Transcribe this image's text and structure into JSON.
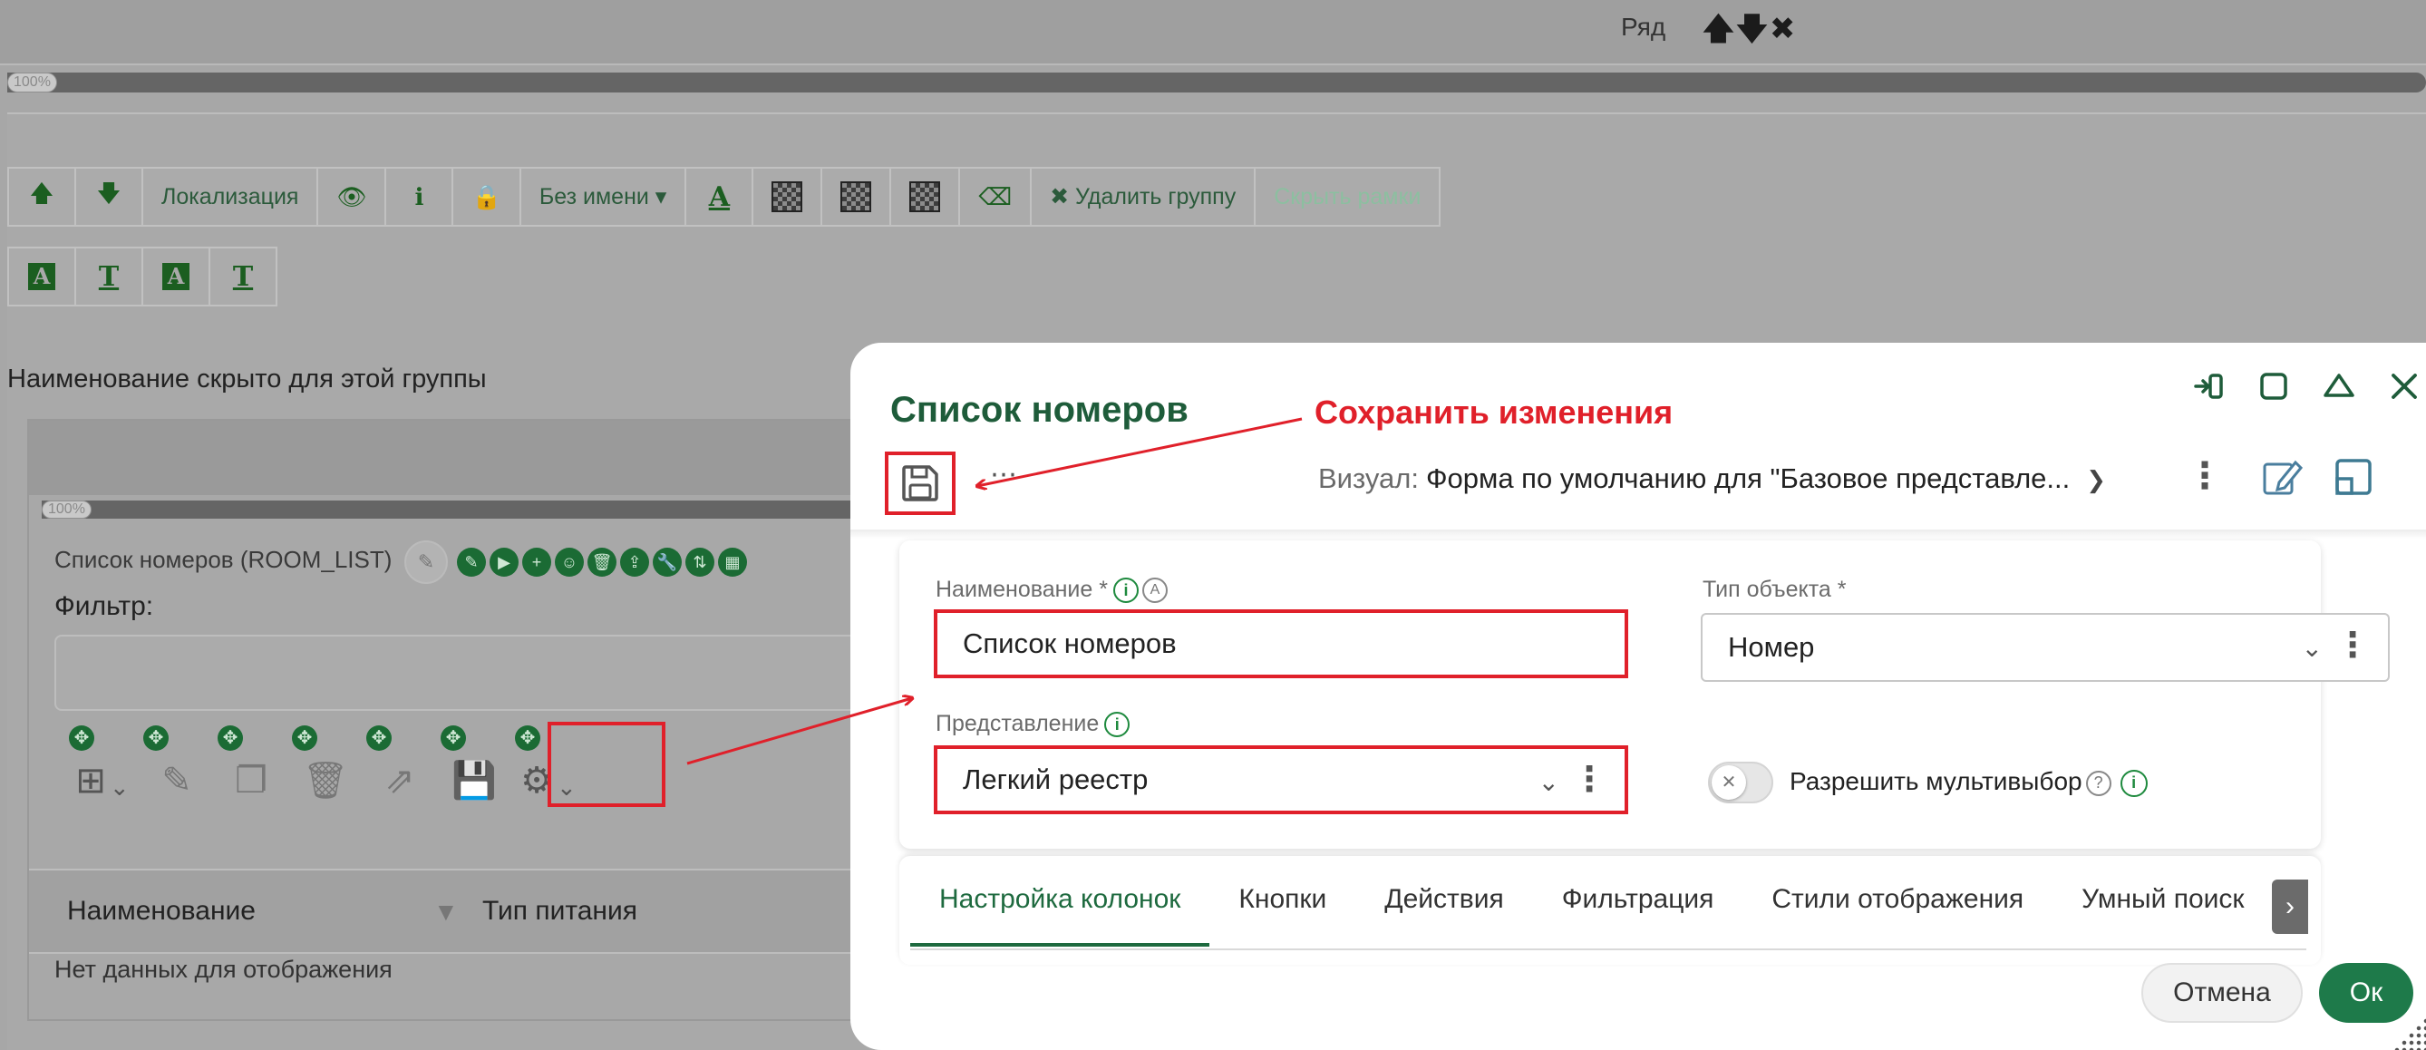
{
  "topbar": {
    "row_label": "Ряд",
    "row_icons": "🡅🡇✖"
  },
  "progress_top": {
    "label": "100%",
    "fill": 1.0
  },
  "toolbar": {
    "localization": "Локализация",
    "no_name": "Без имени ▾",
    "text_a": "A",
    "delete_group": "✖ Удалить группу",
    "hide_frames": "Скрыть рамки"
  },
  "toolbar2": {
    "a1": "A",
    "t1": "T",
    "a2": "A",
    "t2": "T"
  },
  "hidden_name_note": "Наименование скрыто для этой группы",
  "inner": {
    "progress_label": "100%",
    "list_title": "Список номеров (ROOM_LIST)",
    "filter_label": "Фильтр:",
    "col_name": "Наименование",
    "col_food": "Тип питания",
    "no_data": "Нет данных для отображения"
  },
  "dialog": {
    "title": "Список номеров",
    "visual_label": "Визуал:",
    "visual_value": "Форма по умолчанию для \"Базовое представле...",
    "name_label": "Наименование *",
    "name_value": "Список номеров",
    "object_type_label": "Тип объекта *",
    "object_type_value": "Номер",
    "view_label": "Представление",
    "view_value": "Легкий реестр",
    "multiselect_label": "Разрешить мультивыбор",
    "multiselect_enabled": false,
    "tabs": [
      {
        "label": "Настройка колонок",
        "active": true
      },
      {
        "label": "Кнопки"
      },
      {
        "label": "Действия"
      },
      {
        "label": "Фильтрация"
      },
      {
        "label": "Стили отображения"
      },
      {
        "label": "Умный поиск"
      }
    ],
    "cancel_label": "Отмена",
    "ok_label": "Ок"
  },
  "annotation": {
    "text": "Сохранить изменения",
    "color": "#e0202a"
  },
  "colors": {
    "brand_green": "#1e6a3f",
    "highlight_red": "#e0202a"
  }
}
